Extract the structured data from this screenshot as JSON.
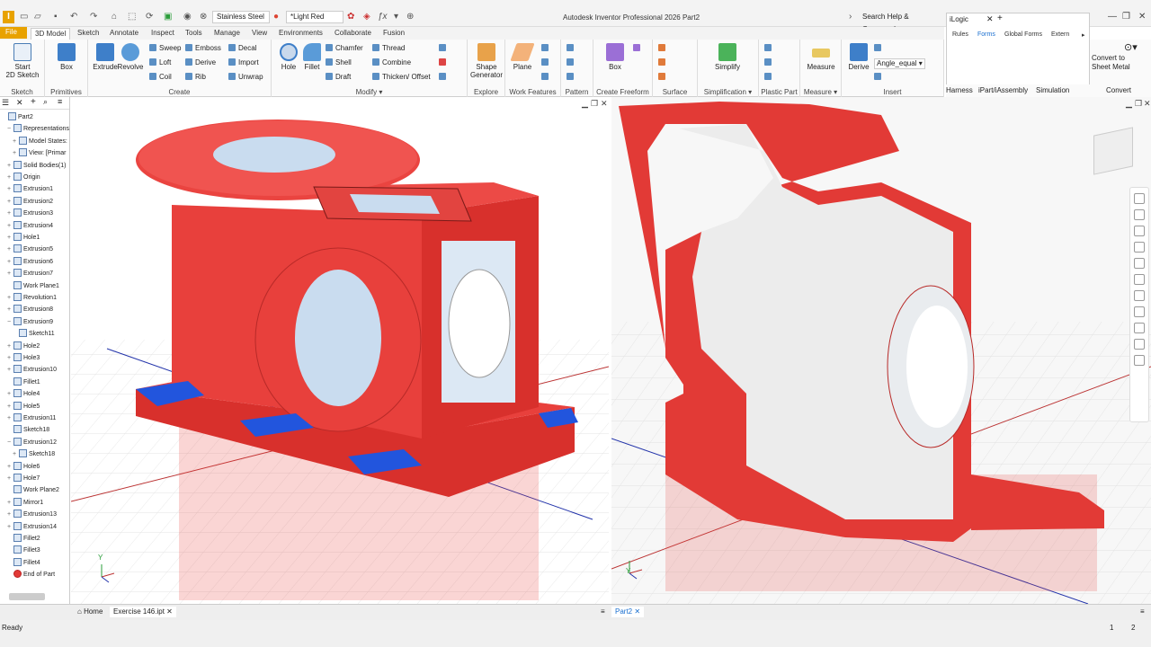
{
  "app": {
    "title": "Autodesk Inventor Professional 2026   Part2",
    "search_placeholder": "Search Help & Commands..."
  },
  "qat": {
    "material": "Stainless Steel",
    "appearance": "*Light Red"
  },
  "tabs": [
    "File",
    "3D Model",
    "Sketch",
    "Annotate",
    "Inspect",
    "Tools",
    "Manage",
    "View",
    "Environments",
    "Collaborate",
    "Fusion"
  ],
  "active_tab": "3D Model",
  "ribbon": {
    "sketch": {
      "label": "Sketch",
      "start": "Start\n2D Sketch"
    },
    "primitives": {
      "label": "Primitives",
      "box": "Box"
    },
    "create": {
      "label": "Create",
      "extrude": "Extrude",
      "revolve": "Revolve",
      "sweep": "Sweep",
      "loft": "Loft",
      "coil": "Coil",
      "emboss": "Emboss",
      "derive": "Derive",
      "rib": "Rib",
      "decal": "Decal",
      "import": "Import",
      "unwrap": "Unwrap"
    },
    "modify": {
      "label": "Modify",
      "hole": "Hole",
      "fillet": "Fillet",
      "chamfer": "Chamfer",
      "shell": "Shell",
      "draft": "Draft",
      "thread": "Thread",
      "combine": "Combine",
      "thicken": "Thicken/ Offset"
    },
    "explore": {
      "label": "Explore",
      "shape": "Shape\nGenerator"
    },
    "workfeatures": {
      "label": "Work Features",
      "plane": "Plane"
    },
    "pattern": {
      "label": "Pattern"
    },
    "freeform": {
      "label": "Create Freeform",
      "box": "Box"
    },
    "surface": {
      "label": "Surface"
    },
    "simplification": {
      "label": "Simplification",
      "simplify": "Simplify"
    },
    "plastic": {
      "label": "Plastic Part"
    },
    "measure": {
      "label": "Measure",
      "measure": "Measure"
    },
    "insert": {
      "label": "Insert",
      "derive": "Derive",
      "param": "Angle_equal"
    }
  },
  "ilogic": {
    "title": "iLogic",
    "tabs": [
      "Rules",
      "Forms",
      "Global Forms",
      "Extern"
    ]
  },
  "ribbonright": {
    "labels": [
      "Harness",
      "iPart/iAssembly",
      "Simulation",
      "Convert"
    ],
    "convert": "Convert to\nSheet Metal"
  },
  "browser": {
    "items": [
      {
        "label": "Part2",
        "indent": 0,
        "pm": ""
      },
      {
        "label": "Representations",
        "indent": 1,
        "pm": "-"
      },
      {
        "label": "Model States:",
        "indent": 2,
        "pm": "+"
      },
      {
        "label": "View: [Primar",
        "indent": 2,
        "pm": "+"
      },
      {
        "label": "Solid Bodies(1)",
        "indent": 1,
        "pm": "+"
      },
      {
        "label": "Origin",
        "indent": 1,
        "pm": "+"
      },
      {
        "label": "Extrusion1",
        "indent": 1,
        "pm": "+"
      },
      {
        "label": "Extrusion2",
        "indent": 1,
        "pm": "+"
      },
      {
        "label": "Extrusion3",
        "indent": 1,
        "pm": "+"
      },
      {
        "label": "Extrusion4",
        "indent": 1,
        "pm": "+"
      },
      {
        "label": "Hole1",
        "indent": 1,
        "pm": "+"
      },
      {
        "label": "Extrusion5",
        "indent": 1,
        "pm": "+"
      },
      {
        "label": "Extrusion6",
        "indent": 1,
        "pm": "+"
      },
      {
        "label": "Extrusion7",
        "indent": 1,
        "pm": "+"
      },
      {
        "label": "Work Plane1",
        "indent": 1,
        "pm": ""
      },
      {
        "label": "Revolution1",
        "indent": 1,
        "pm": "+"
      },
      {
        "label": "Extrusion8",
        "indent": 1,
        "pm": "+"
      },
      {
        "label": "Extrusion9",
        "indent": 1,
        "pm": "-"
      },
      {
        "label": "Sketch11",
        "indent": 2,
        "pm": ""
      },
      {
        "label": "Hole2",
        "indent": 1,
        "pm": "+"
      },
      {
        "label": "Hole3",
        "indent": 1,
        "pm": "+"
      },
      {
        "label": "Extrusion10",
        "indent": 1,
        "pm": "+"
      },
      {
        "label": "Fillet1",
        "indent": 1,
        "pm": ""
      },
      {
        "label": "Hole4",
        "indent": 1,
        "pm": "+"
      },
      {
        "label": "Hole5",
        "indent": 1,
        "pm": "+"
      },
      {
        "label": "Extrusion11",
        "indent": 1,
        "pm": "+"
      },
      {
        "label": "Sketch18",
        "indent": 1,
        "pm": ""
      },
      {
        "label": "Extrusion12",
        "indent": 1,
        "pm": "-"
      },
      {
        "label": "Sketch18",
        "indent": 2,
        "pm": "+"
      },
      {
        "label": "Hole6",
        "indent": 1,
        "pm": "+"
      },
      {
        "label": "Hole7",
        "indent": 1,
        "pm": "+"
      },
      {
        "label": "Work Plane2",
        "indent": 1,
        "pm": ""
      },
      {
        "label": "Mirror1",
        "indent": 1,
        "pm": "+"
      },
      {
        "label": "Extrusion13",
        "indent": 1,
        "pm": "+"
      },
      {
        "label": "Extrusion14",
        "indent": 1,
        "pm": "+"
      },
      {
        "label": "Fillet2",
        "indent": 1,
        "pm": ""
      },
      {
        "label": "Fillet3",
        "indent": 1,
        "pm": ""
      },
      {
        "label": "Fillet4",
        "indent": 1,
        "pm": ""
      },
      {
        "label": "End of Part",
        "indent": 1,
        "pm": ""
      }
    ]
  },
  "doc_tabs": {
    "home": "Home",
    "file": "Exercise 146.ipt",
    "part": "Part2"
  },
  "status": {
    "text": "Ready",
    "n1": "1",
    "n2": "2"
  },
  "colors": {
    "part_red": "#e8403c",
    "accent": "#e8a200",
    "flange_blue": "#2255dd"
  }
}
